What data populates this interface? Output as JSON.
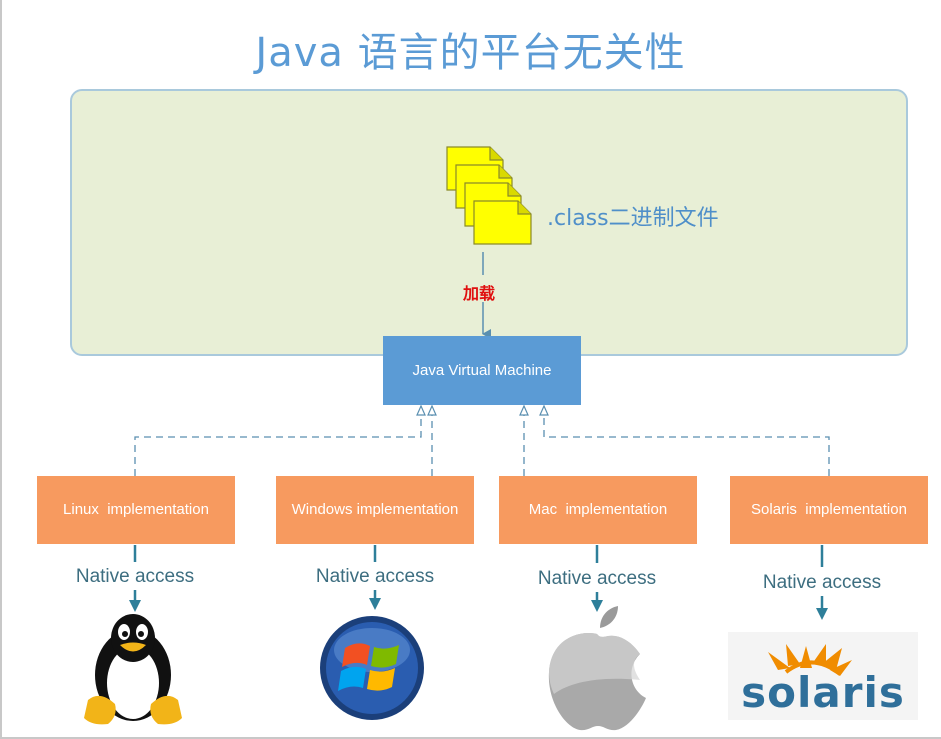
{
  "title": "Java 语言的平台无关性",
  "class_files_label": ".class二进制文件",
  "load_label": "加载",
  "jvm_label": "Java Virtual Machine",
  "implementations": [
    {
      "label": "Linux  implementation",
      "native": "Native access",
      "os": "Linux"
    },
    {
      "label": "Windows implementation",
      "native": "Native access",
      "os": "Windows"
    },
    {
      "label": "Mac  implementation",
      "native": "Native access",
      "os": "Mac"
    },
    {
      "label": "Solaris  implementation",
      "native": "Native access",
      "os": "Solaris"
    }
  ],
  "solaris_logo_text": "solaris",
  "colors": {
    "title": "#5b9bd5",
    "env_fill": "#e8efd6",
    "jvm_fill": "#5b9bd5",
    "impl_fill": "#f79a5f",
    "native_text": "#3d6e80",
    "load_text": "#e01010",
    "file_fill": "#ffff00"
  }
}
